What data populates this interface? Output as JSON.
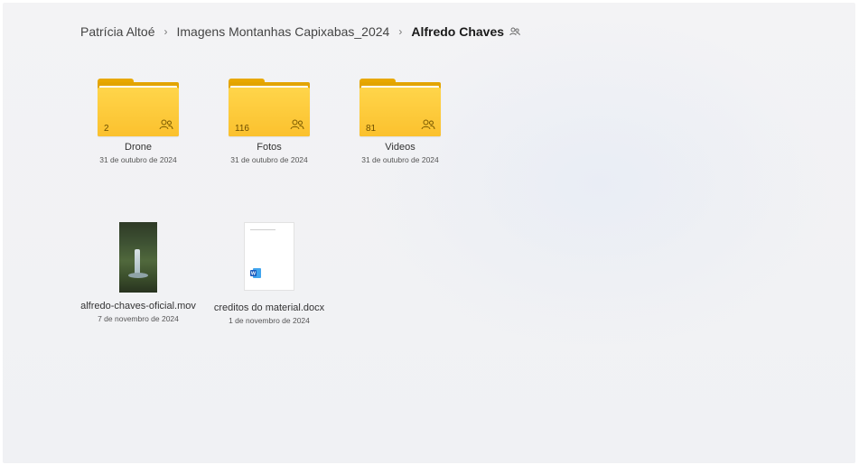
{
  "breadcrumb": {
    "items": [
      "Patrícia Altoé",
      "Imagens Montanhas Capixabas_2024",
      "Alfredo Chaves"
    ],
    "separator": "›"
  },
  "folders": [
    {
      "name": "Drone",
      "date": "31 de outubro de 2024",
      "count": "2",
      "icon": "people-shared-icon"
    },
    {
      "name": "Fotos",
      "date": "31 de outubro de 2024",
      "count": "116",
      "icon": "people-shared-icon"
    },
    {
      "name": "Videos",
      "date": "31 de outubro de 2024",
      "count": "81",
      "icon": "people-shared-icon"
    }
  ],
  "files": [
    {
      "name": "alfredo-chaves-oficial.mov",
      "date": "7 de novembro de 2024",
      "icon": "video-thumbnail"
    },
    {
      "name": "creditos do material.docx",
      "date": "1 de novembro de 2024",
      "icon": "word-doc-icon"
    }
  ],
  "colors": {
    "folder_front": "#fbc12e",
    "folder_back": "#e3a400",
    "word_blue": "#185abd"
  }
}
